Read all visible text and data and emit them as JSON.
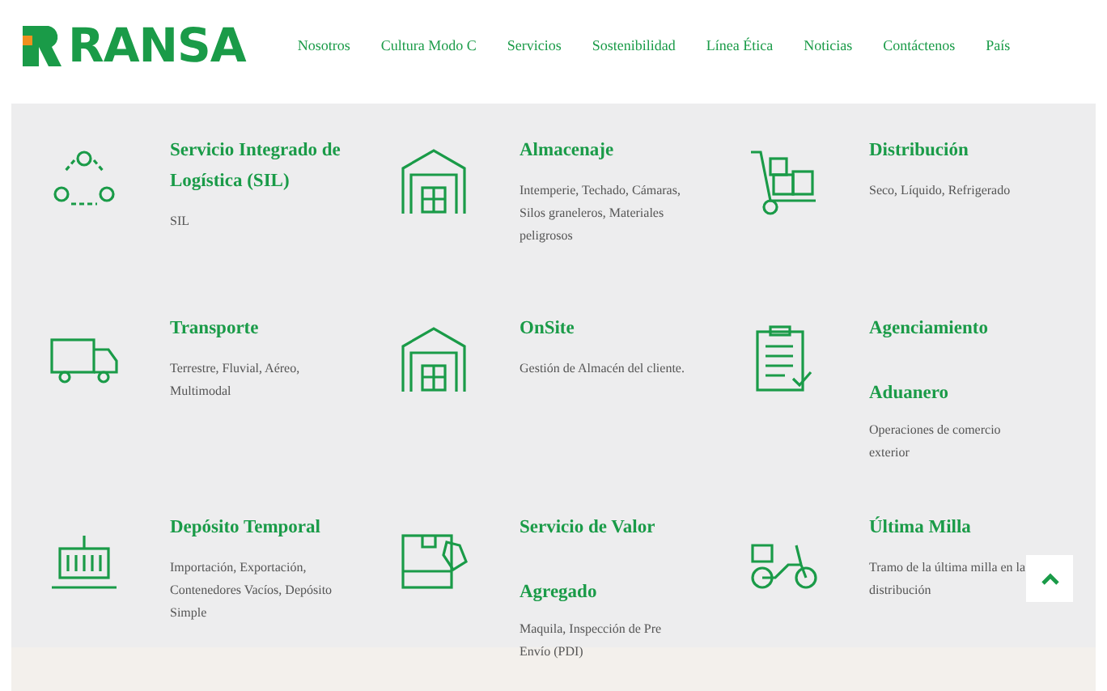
{
  "header": {
    "logo_text": "RANSA",
    "nav": [
      {
        "label": "Nosotros"
      },
      {
        "label": "Cultura Modo C"
      },
      {
        "label": "Servicios"
      },
      {
        "label": "Sostenibilidad"
      },
      {
        "label": "Línea Ética"
      },
      {
        "label": "Noticias"
      },
      {
        "label": "Contáctenos"
      },
      {
        "label": "País"
      }
    ]
  },
  "services": [
    {
      "kind": "normal",
      "title": "Servicio Integrado de Logística (SIL)",
      "description": "SIL"
    },
    {
      "kind": "normal",
      "title": "Almacenaje",
      "description": "Intemperie, Techado, Cámaras, Silos graneleros, Materiales peligrosos"
    },
    {
      "kind": "normal",
      "title": "Distribución",
      "description": "Seco, Líquido, Refrigerado"
    },
    {
      "kind": "normal",
      "title": "Transporte",
      "description": "Terrestre, Fluvial, Aéreo, Multimodal"
    },
    {
      "kind": "normal",
      "title": "OnSite",
      "description": "Gestión de Almacén del cliente."
    },
    {
      "kind": "spaced",
      "title": "Agenciamiento Aduanero",
      "description": "Operaciones de comercio exterior"
    },
    {
      "kind": "normal",
      "title": "Depósito Temporal",
      "description": "Importación, Exportación, Contenedores Vacíos, Depósito Simple"
    },
    {
      "kind": "spaced",
      "title": "Servicio de Valor Agregado",
      "description": "Maquila, Inspección de Pre Envío (PDI)"
    },
    {
      "kind": "normal",
      "title": "Última Milla",
      "description": "Tramo de la última milla en la distribución"
    }
  ]
}
